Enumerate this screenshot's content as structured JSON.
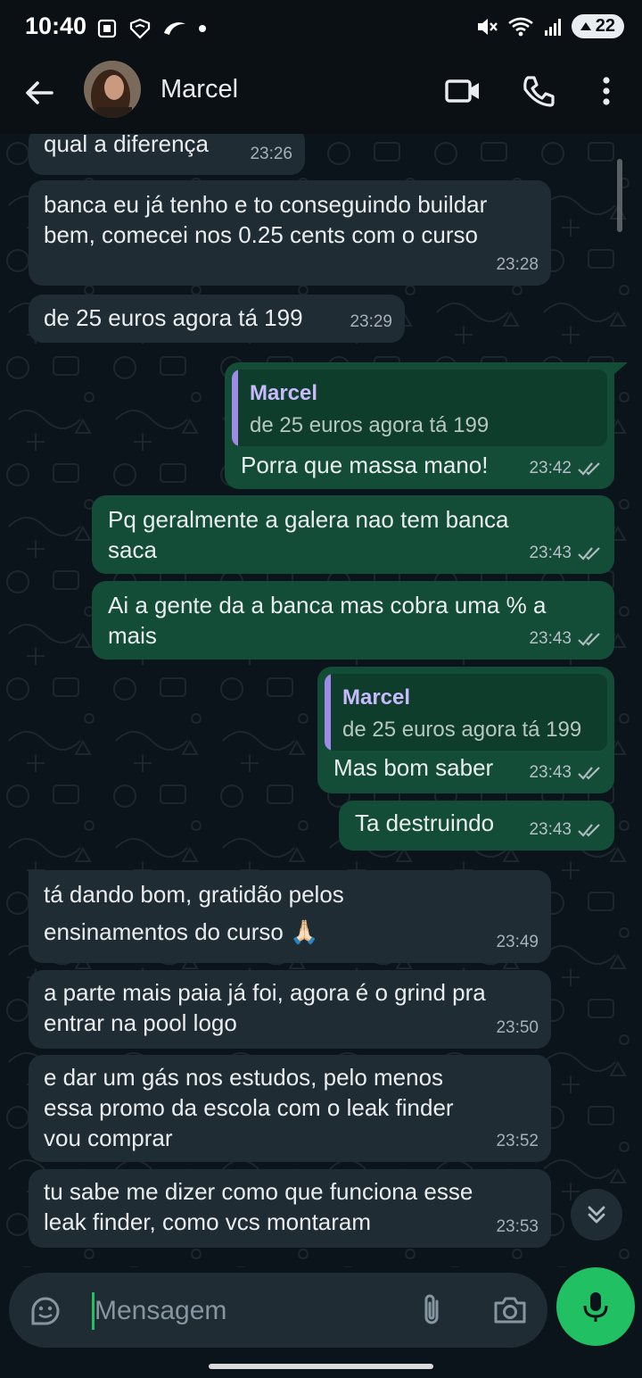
{
  "status_bar": {
    "time": "10:40",
    "battery": "22"
  },
  "header": {
    "contact_name": "Marcel"
  },
  "messages": [
    {
      "dir": "in",
      "text": "qual a diferença",
      "time": "23:26"
    },
    {
      "dir": "in",
      "text": "banca eu já tenho e to conseguindo buildar\nbem, comecei nos 0.25 cents com o curso",
      "time": "23:28"
    },
    {
      "dir": "in",
      "text": "de 25 euros agora tá 199",
      "time": "23:29"
    },
    {
      "dir": "out",
      "quote_name": "Marcel",
      "quote_text": "de 25 euros agora tá 199",
      "text": "Porra que massa mano!",
      "time": "23:42"
    },
    {
      "dir": "out",
      "text": "Pq geralmente a galera nao tem banca\nsaca",
      "time": "23:43"
    },
    {
      "dir": "out",
      "text": "Ai a gente da a banca mas cobra uma % a\nmais",
      "time": "23:43"
    },
    {
      "dir": "out",
      "quote_name": "Marcel",
      "quote_text": "de 25 euros agora tá 199",
      "text": "Mas bom saber",
      "time": "23:43"
    },
    {
      "dir": "out",
      "text": "Ta destruindo",
      "time": "23:43"
    },
    {
      "dir": "in",
      "text": "tá dando bom, gratidão pelos\nensinamentos do curso 🙏🏻",
      "time": "23:49"
    },
    {
      "dir": "in",
      "text": "a parte mais paia já foi, agora é o grind pra\nentrar na pool logo",
      "time": "23:50"
    },
    {
      "dir": "in",
      "text": "e dar um gás nos estudos, pelo menos\nessa promo da escola com o leak finder\nvou comprar",
      "time": "23:52"
    },
    {
      "dir": "in",
      "text": "tu sabe me dizer como que funciona esse\nleak finder, como vcs montaram",
      "time": "23:53"
    }
  ],
  "composer": {
    "placeholder": "Mensagem"
  },
  "colors": {
    "incoming_bubble": "#202c33",
    "outgoing_bubble": "#144d37",
    "accent": "#21c063",
    "quote_accent": "#a08ae8"
  },
  "icons": [
    "back-arrow-icon",
    "video-call-icon",
    "phone-icon",
    "more-vert-icon",
    "sticker-icon",
    "attach-icon",
    "camera-icon",
    "mic-icon",
    "scroll-down-icon",
    "read-receipt-icon"
  ]
}
